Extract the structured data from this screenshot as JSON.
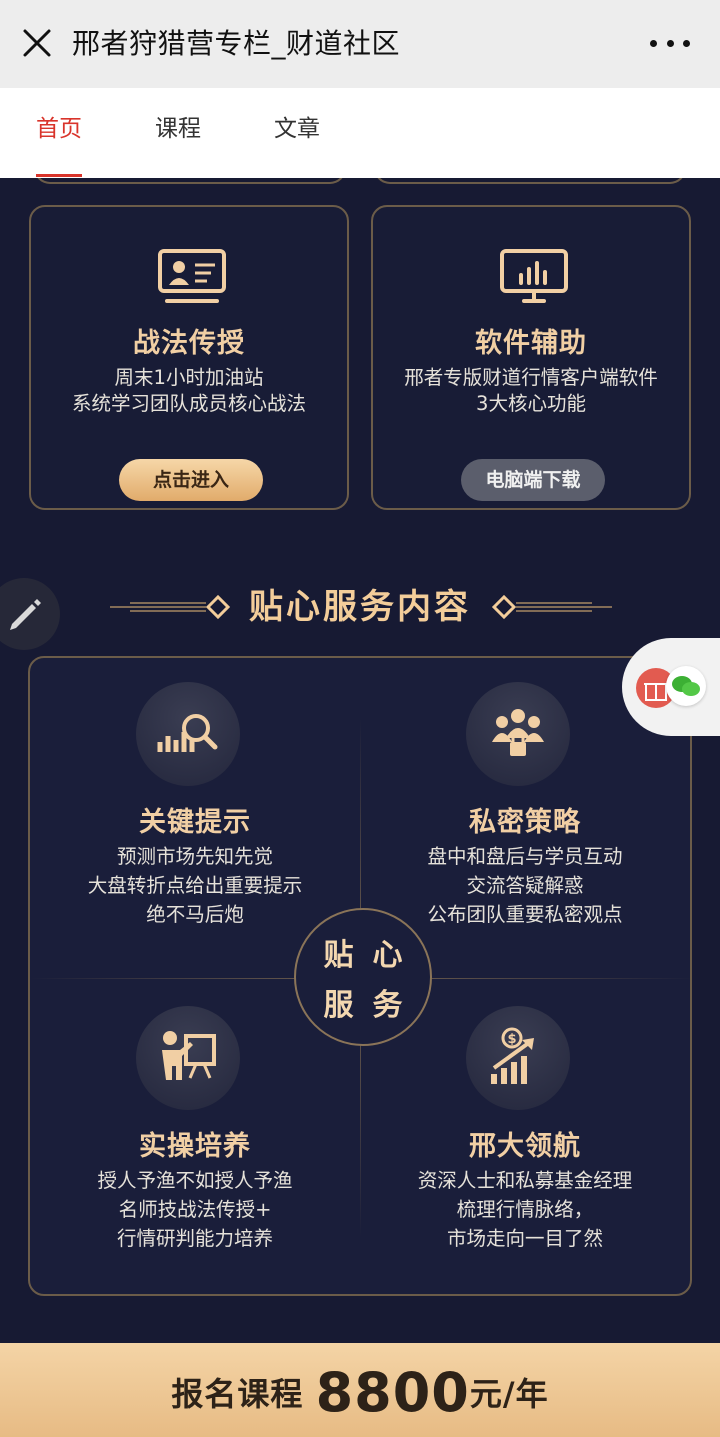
{
  "header": {
    "title": "邢者狩猎营专栏_财道社区"
  },
  "tabs": [
    {
      "label": "首页",
      "active": true
    },
    {
      "label": "课程",
      "active": false
    },
    {
      "label": "文章",
      "active": false
    }
  ],
  "cards": [
    {
      "title": "战法传授",
      "desc_lines": [
        "周末1小时加油站",
        "系统学习团队成员核心战法"
      ],
      "button": "点击进入",
      "icon": "teacher-board-icon"
    },
    {
      "title": "软件辅助",
      "desc_lines": [
        "邢者专版财道行情客户端软件",
        "3大核心功能"
      ],
      "button": "电脑端下载",
      "icon": "monitor-chart-icon"
    }
  ],
  "section": {
    "title": "贴心服务内容"
  },
  "services": [
    {
      "title": "关键提示",
      "lines": [
        "预测市场先知先觉",
        "大盘转折点给出重要提示",
        "绝不马后炮"
      ],
      "icon": "chart-magnifier-icon"
    },
    {
      "title": "私密策略",
      "lines": [
        "盘中和盘后与学员互动",
        "交流答疑解惑",
        "公布团队重要私密观点"
      ],
      "icon": "group-lock-icon"
    },
    {
      "title": "实操培养",
      "lines": [
        "授人予渔不如授人予渔",
        "名师技战法传授+",
        "行情研判能力培养"
      ],
      "icon": "presenter-board-icon"
    },
    {
      "title": "邢大领航",
      "lines": [
        "资深人士和私募基金经理",
        "梳理行情脉络，",
        "市场走向一目了然"
      ],
      "icon": "dollar-growth-icon"
    }
  ],
  "center_badge": {
    "chars": [
      "贴",
      "心",
      "服",
      "务"
    ]
  },
  "bottom": {
    "prefix": "报名课程",
    "price": "8800",
    "suffix": "元/年"
  },
  "colors": {
    "accent_red": "#d9342b",
    "gold": "#f1cfa4",
    "background": "#171a33"
  }
}
